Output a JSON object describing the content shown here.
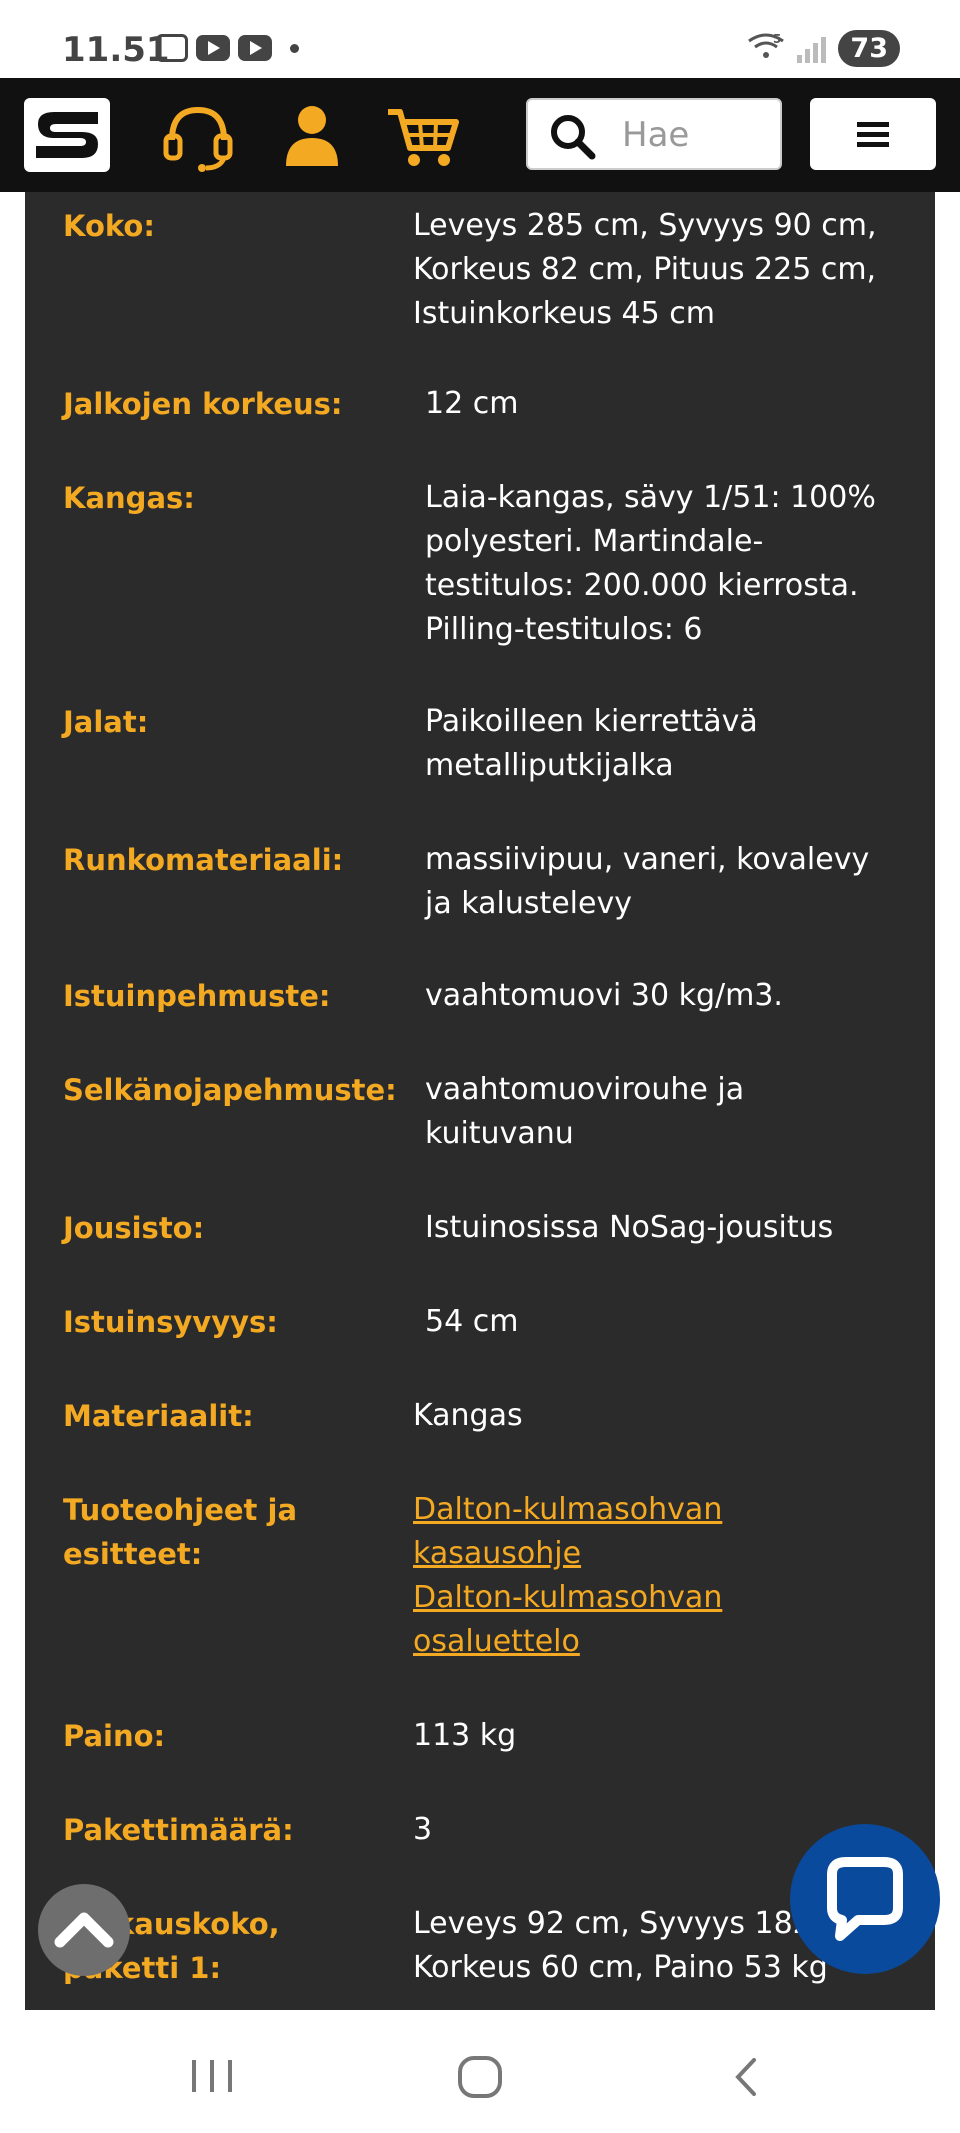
{
  "status_bar": {
    "time": "11.51",
    "wifi_badge": "5",
    "battery": "73"
  },
  "header": {
    "search": {
      "placeholder": "Hae"
    },
    "colors": {
      "background": "#111111",
      "accent": "#f4a922"
    }
  },
  "specs": [
    {
      "label": "Koko:",
      "value": [
        "Leveys 285 cm, Syvyys 90 cm,",
        "Korkeus 82 cm, Pituus 225 cm,",
        "Istuinkorkeus 45 cm"
      ]
    },
    {
      "label": "Jalkojen korkeus:",
      "value": [
        "12 cm"
      ]
    },
    {
      "label": "Kangas:",
      "value": [
        "Laia-kangas, sävy 1/51: 100%",
        "polyesteri. Martindale-",
        "testitulos: 200.000 kierrosta.",
        "Pilling-testitulos: 6"
      ]
    },
    {
      "label": "Jalat:",
      "value": [
        "Paikoilleen kierrettävä",
        "metalliputkijalka"
      ]
    },
    {
      "label": "Runkomateriaali:",
      "value": [
        "massiivipuu, vaneri, kovalevy",
        "ja kalustelevy"
      ]
    },
    {
      "label": "Istuinpehmuste:",
      "value": [
        "vaahtomuovi 30 kg/m3."
      ]
    },
    {
      "label": "Selkänojapehmuste:",
      "value": [
        "vaahtomuovirouhe ja",
        "kuituvanu"
      ]
    },
    {
      "label": "Jousisto:",
      "value": [
        "Istuinosissa NoSag-jousitus"
      ]
    },
    {
      "label": "Istuinsyvyys:",
      "value": [
        "54 cm"
      ]
    },
    {
      "label": "Materiaalit:",
      "value": [
        "Kangas"
      ]
    },
    {
      "label_lines": [
        "Tuoteohjeet ja",
        "esitteet:"
      ],
      "links": [
        [
          "Dalton-kulmasohvan",
          "kasausohje"
        ],
        [
          "Dalton-kulmasohvan",
          "osaluettelo"
        ]
      ]
    },
    {
      "label": "Paino:",
      "value": [
        "113 kg"
      ]
    },
    {
      "label": "Pakettimäärä:",
      "value": [
        "3"
      ]
    },
    {
      "label_lines": [
        "kauskoko,",
        "paketti 1:"
      ],
      "value": [
        "Leveys 92 cm, Syvyys 182",
        "Korkeus 60 cm, Paino 53 kg"
      ]
    }
  ]
}
